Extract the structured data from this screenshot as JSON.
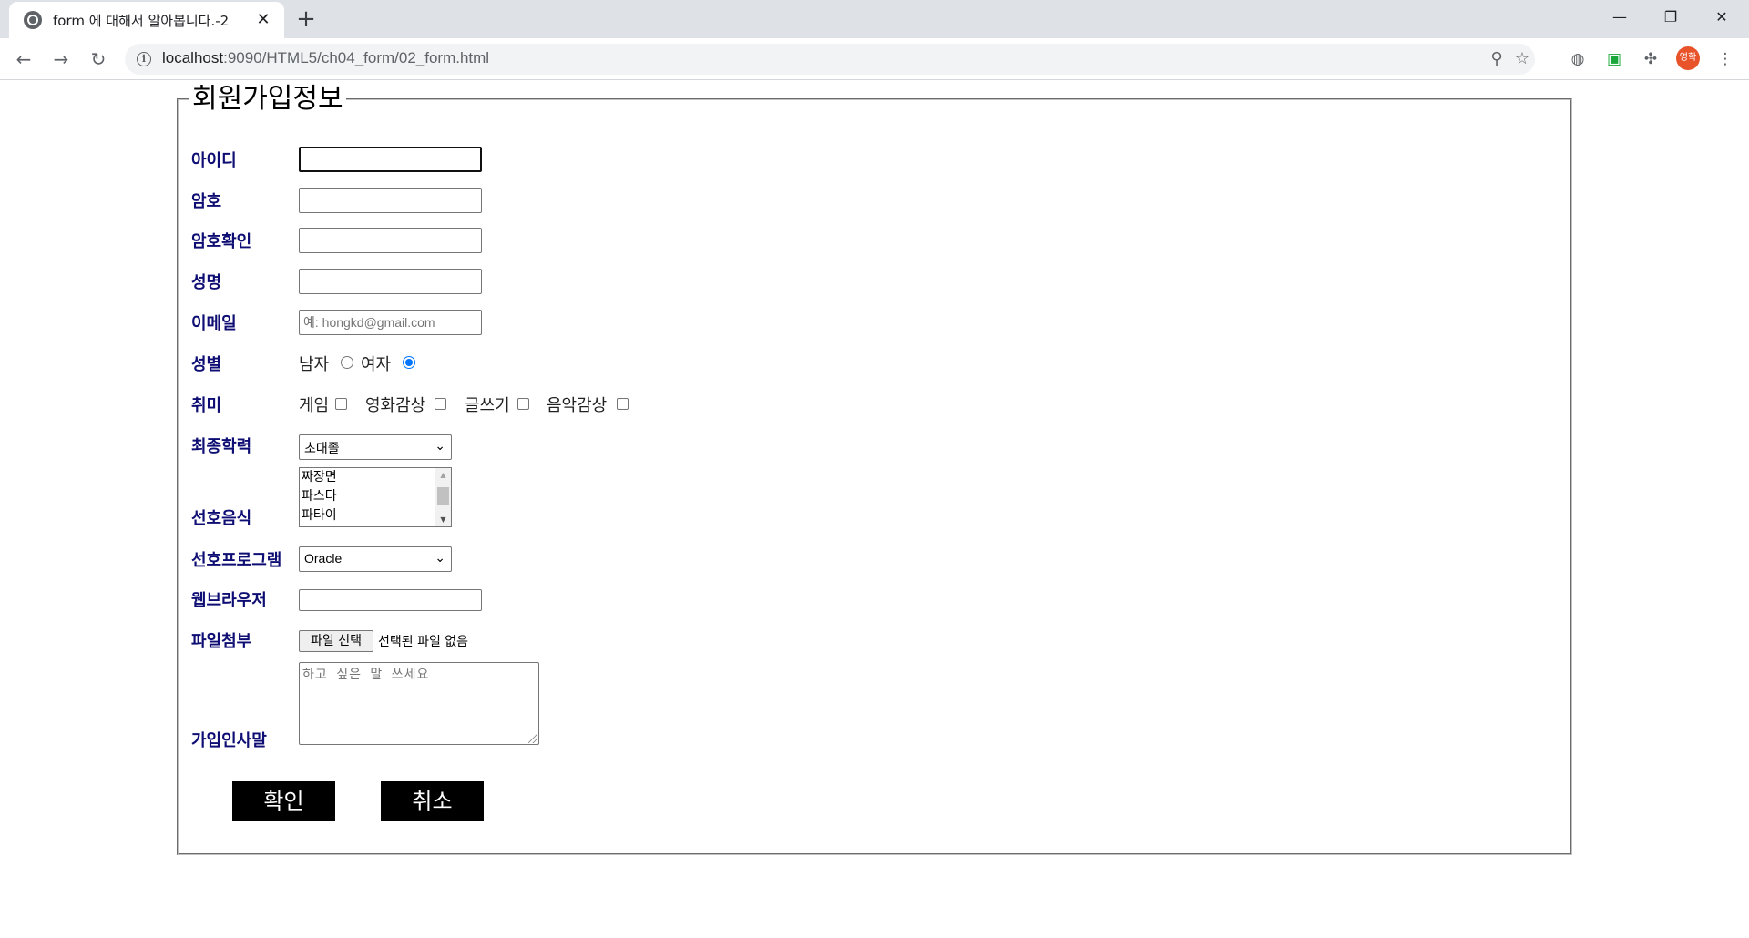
{
  "browser": {
    "tab_title": "form 에 대해서 알아봅니다.-2",
    "url_host": "localhost",
    "url_path": ":9090/HTML5/ch04_form/02_form.html",
    "profile_initials": "영학"
  },
  "form": {
    "legend": "회원가입정보",
    "labels": {
      "id": "아이디",
      "password": "암호",
      "password_confirm": "암호확인",
      "name": "성명",
      "email": "이메일",
      "gender": "성별",
      "hobby": "취미",
      "education": "최종학력",
      "food": "선호음식",
      "program": "선호프로그램",
      "browser": "웹브라우저",
      "file": "파일첨부",
      "greeting": "가입인사말"
    },
    "email_placeholder": "예: hongkd@gmail.com",
    "gender_options": {
      "male": "남자",
      "female": "여자"
    },
    "gender_selected": "female",
    "hobbies": {
      "game": "게임",
      "movie": "영화감상",
      "writing": "글쓰기",
      "music": "음악감상"
    },
    "education_selected": "초대졸",
    "food_options": [
      "짜장면",
      "파스타",
      "파타이"
    ],
    "program_selected": "Oracle",
    "file_button": "파일 선택",
    "file_status": "선택된 파일 없음",
    "greeting_placeholder": "하고 싶은 말 쓰세요",
    "submit_label": "확인",
    "cancel_label": "취소"
  }
}
